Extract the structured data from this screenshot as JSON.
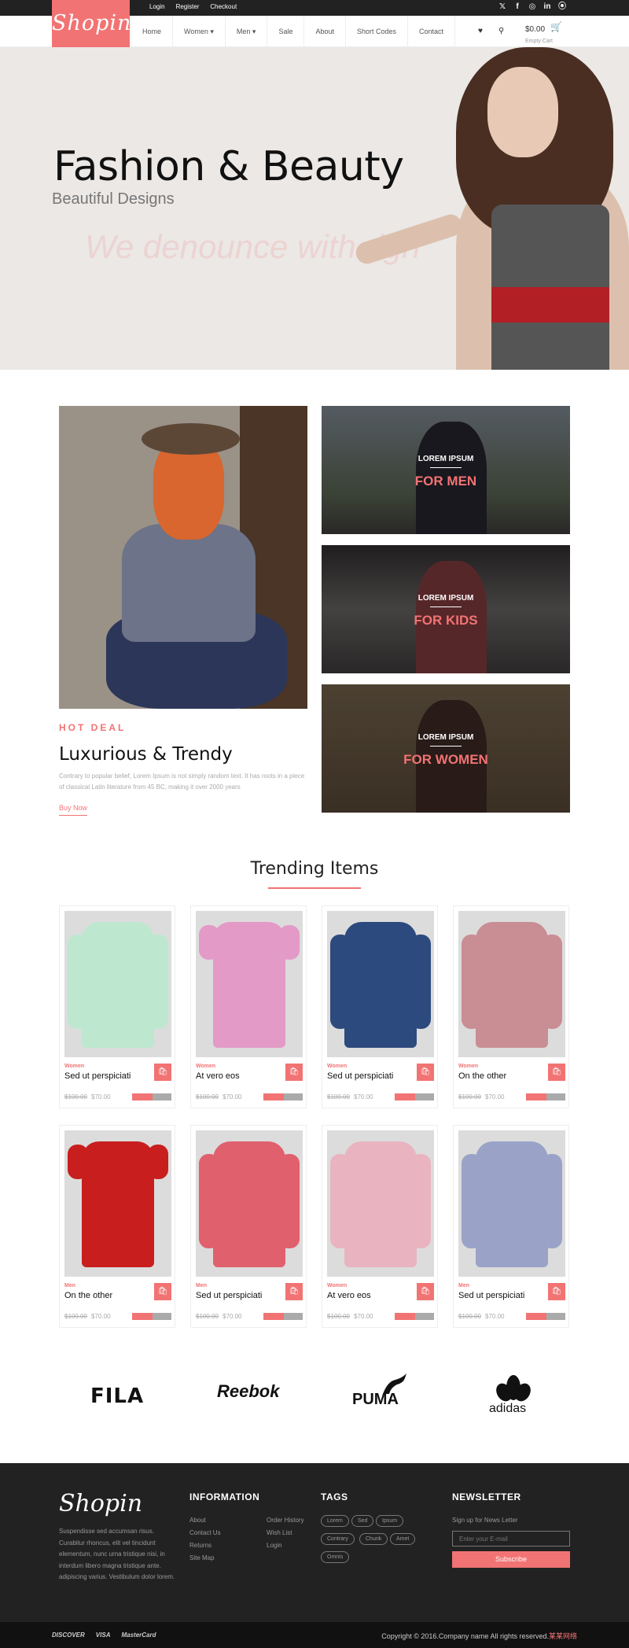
{
  "topbar": {
    "links": [
      "Login",
      "Register",
      "Checkout"
    ],
    "social_icons": [
      "twitter-icon",
      "facebook-icon",
      "dribbble-icon",
      "linkedin-icon",
      "rss-icon"
    ]
  },
  "nav": {
    "logo": "Shopin",
    "menu": [
      "Home",
      "Women",
      "Men",
      "Sale",
      "About",
      "Short Codes",
      "Contact"
    ],
    "cart_amount": "$0.00",
    "cart_status": "Empty Cart"
  },
  "hero": {
    "title": "Fashion & Beauty",
    "subtitle": "Beautiful Designs",
    "ghost_text": "We denounce with righ"
  },
  "promo": {
    "label": "HOT DEAL",
    "title": "Luxurious & Trendy",
    "text": "Contrary to popular belief, Lorem Ipsum is not simply random text. It has roots in a piece of classical Latin literature from 45 BC, making it over 2000 years",
    "link": "Buy Now",
    "categories": [
      {
        "small": "LOREM IPSUM",
        "big": "FOR MEN"
      },
      {
        "small": "LOREM IPSUM",
        "big": "FOR KIDS"
      },
      {
        "small": "LOREM IPSUM",
        "big": "FOR WOMEN"
      }
    ]
  },
  "trending": {
    "title": "Trending Items",
    "products": [
      {
        "category": "Women",
        "name": "Sed ut perspiciati",
        "old_price": "$100.00",
        "price": "$70.00"
      },
      {
        "category": "Women",
        "name": "At vero eos",
        "old_price": "$100.00",
        "price": "$70.00"
      },
      {
        "category": "Women",
        "name": "Sed ut perspiciati",
        "old_price": "$100.00",
        "price": "$70.00"
      },
      {
        "category": "Women",
        "name": "On the other",
        "old_price": "$100.00",
        "price": "$70.00"
      },
      {
        "category": "Men",
        "name": "On the other",
        "old_price": "$100.00",
        "price": "$70.00"
      },
      {
        "category": "Men",
        "name": "Sed ut perspiciati",
        "old_price": "$100.00",
        "price": "$70.00"
      },
      {
        "category": "Women",
        "name": "At vero eos",
        "old_price": "$100.00",
        "price": "$70.00"
      },
      {
        "category": "Men",
        "name": "Sed ut perspiciati",
        "old_price": "$100.00",
        "price": "$70.00"
      }
    ]
  },
  "brands": [
    "FILA",
    "Reebok",
    "PUMA",
    "adidas"
  ],
  "footer": {
    "logo": "Shopin",
    "about": "Suspendisse sed accumsan risus. Curabitur rhoncus, elit vel tincidunt elementum, nunc urna tristique nisi, in interdum libero magna tristique ante. adipiscing varius. Vestibulum dolor lorem.",
    "info_title": "INFORMATION",
    "info_col1": [
      "About",
      "Contact Us",
      "Returns",
      "Site Map"
    ],
    "info_col2": [
      "Order History",
      "Wish List",
      "Login"
    ],
    "tags_title": "TAGS",
    "tags": [
      "Lorem",
      "Sed",
      "Ipsum",
      "Contrary",
      "Chunk",
      "Amet",
      "Omnis"
    ],
    "newsletter_title": "NEWSLETTER",
    "newsletter_label": "Sign up for News Letter",
    "newsletter_placeholder": "Enter your E-mail",
    "subscribe": "Subscribe",
    "payments": [
      "DISCOVER",
      "VISA",
      "MasterCard"
    ],
    "copyright": "Copyright © 2016.Company name All rights reserved.",
    "copyright_link": "某某网络"
  },
  "colors": {
    "accent": "#f27373",
    "dark": "#222222"
  }
}
